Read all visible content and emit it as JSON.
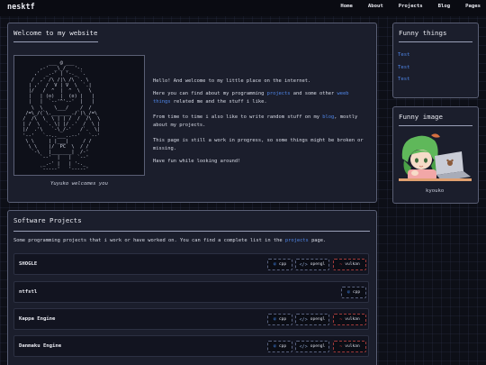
{
  "site": {
    "logo": "nesktf"
  },
  "nav": [
    {
      "label": "Home"
    },
    {
      "label": "About"
    },
    {
      "label": "Projects"
    },
    {
      "label": "Blog"
    },
    {
      "label": "Pages"
    }
  ],
  "welcome": {
    "title": "Welcome to my website",
    "ascii_caption": "Yuyuko welcomes you",
    "paragraphs": {
      "p1": "Hello! And welcome to my little place on the internet.",
      "p2_a": "Here you can find about my programming",
      "p2_link1": "projects",
      "p2_b": "and some other",
      "p2_link2": "weeb things",
      "p2_c": "related me and the stuff i like.",
      "p3_a": "From time to time i also like to write random stuff on my",
      "p3_link": "blog",
      "p3_b": ", mostly about my projects.",
      "p4": "This page is still a work in progress, so some things might be broken or missing.",
      "p5": "Have fun while looking around!"
    }
  },
  "funny_things": {
    "title": "Funny things",
    "items": [
      "Test",
      "Test",
      "Test"
    ]
  },
  "funny_image": {
    "title": "Funny image",
    "caption": "kyouko"
  },
  "projects": {
    "title": "Software Projects",
    "intro_a": "Some programming projects that i work or have worked on. You can find a complete list in the",
    "intro_link": "projects",
    "intro_b": "page.",
    "rows": [
      {
        "name": "SHOGLE",
        "tags": [
          "cpp",
          "opengl",
          "vulkan"
        ]
      },
      {
        "name": "ntfstl",
        "tags": [
          "cpp"
        ]
      },
      {
        "name": "Kappa Engine",
        "tags": [
          "cpp",
          "opengl",
          "vulkan"
        ]
      },
      {
        "name": "Danmaku Engine",
        "tags": [
          "cpp",
          "opengl",
          "vulkan"
        ]
      }
    ]
  },
  "colors": {
    "accent_link": "#4f86e8",
    "vulkan": "#d03a3a",
    "cpp": "#3b7bd8"
  },
  "icons": {
    "cpp": "cpp-icon",
    "opengl": "opengl-icon",
    "vulkan": "vulkan-icon"
  }
}
